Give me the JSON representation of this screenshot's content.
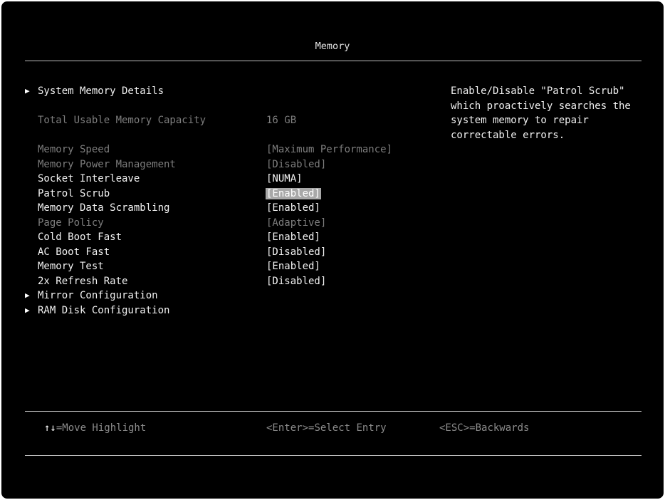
{
  "page": {
    "title": "Memory"
  },
  "menu": [
    {
      "id": "system-memory-details",
      "type": "submenu",
      "label": "System Memory Details",
      "value": "",
      "state": "active"
    },
    {
      "id": "total-usable-memory-capacity",
      "type": "info",
      "label": "Total Usable Memory Capacity",
      "value": "16 GB",
      "state": "dim"
    },
    {
      "id": "memory-speed",
      "type": "setting",
      "label": "Memory Speed",
      "value": "[Maximum Performance]",
      "state": "dim"
    },
    {
      "id": "memory-power-management",
      "type": "setting",
      "label": "Memory Power Management",
      "value": "[Disabled]",
      "state": "dim"
    },
    {
      "id": "socket-interleave",
      "type": "setting",
      "label": "Socket Interleave",
      "value": "[NUMA]",
      "state": "active"
    },
    {
      "id": "patrol-scrub",
      "type": "setting",
      "label": "Patrol Scrub",
      "value": "[Enabled]",
      "state": "selected"
    },
    {
      "id": "memory-data-scrambling",
      "type": "setting",
      "label": "Memory Data Scrambling",
      "value": "[Enabled]",
      "state": "active"
    },
    {
      "id": "page-policy",
      "type": "setting",
      "label": "Page Policy",
      "value": "[Adaptive]",
      "state": "dim"
    },
    {
      "id": "cold-boot-fast",
      "type": "setting",
      "label": "Cold Boot Fast",
      "value": "[Enabled]",
      "state": "active"
    },
    {
      "id": "ac-boot-fast",
      "type": "setting",
      "label": "AC Boot Fast",
      "value": "[Disabled]",
      "state": "active"
    },
    {
      "id": "memory-test",
      "type": "setting",
      "label": "Memory Test",
      "value": "[Enabled]",
      "state": "active"
    },
    {
      "id": "2x-refresh-rate",
      "type": "setting",
      "label": "2x Refresh Rate",
      "value": "[Disabled]",
      "state": "active"
    },
    {
      "id": "mirror-configuration",
      "type": "submenu",
      "label": "Mirror Configuration",
      "value": "",
      "state": "active"
    },
    {
      "id": "ram-disk-configuration",
      "type": "submenu",
      "label": "RAM Disk Configuration",
      "value": "",
      "state": "active"
    }
  ],
  "help": {
    "text": "Enable/Disable \"Patrol Scrub\"\nwhich proactively searches the\nsystem memory to repair\ncorrectable errors."
  },
  "footer": {
    "move": {
      "key": "↑↓",
      "text": "=Move Highlight"
    },
    "select": {
      "key": "<Enter>",
      "text": "=Select Entry"
    },
    "back": {
      "key": "<ESC>",
      "text": "=Backwards"
    }
  },
  "colors": {
    "background": "#000000",
    "text": "#ffffff",
    "dim_text": "#7d7d7d",
    "highlight": "#a8a8a8",
    "rule": "#bdbdbd"
  },
  "icons": {
    "submenu": "triangle-right-icon",
    "move": "up-down-arrows-icon"
  }
}
